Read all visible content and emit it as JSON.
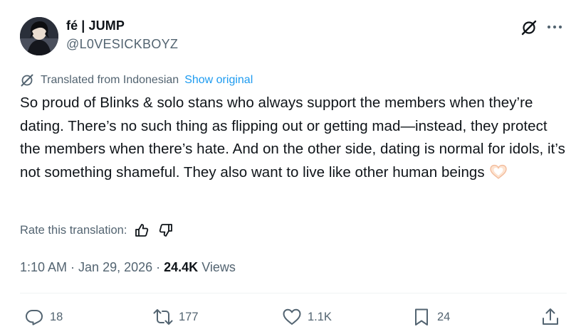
{
  "author": {
    "display_name": "fé | JUMP",
    "handle": "@L0VESICKBOYZ"
  },
  "icons": {
    "grok": "grok-slash-icon",
    "more": "more-dots-icon",
    "translate": "translate-icon",
    "thumbs_up": "thumbs-up-icon",
    "thumbs_down": "thumbs-down-icon",
    "reply": "reply-icon",
    "retweet": "retweet-icon",
    "like": "heart-icon",
    "bookmark": "bookmark-icon",
    "share": "share-icon",
    "emoji": "heart-hands-emoji"
  },
  "translation": {
    "notice": "Translated from Indonesian",
    "show_original": "Show original"
  },
  "tweet": {
    "text": "So proud of Blinks & solo stans who always support the members when they’re dating. There’s no such thing as flipping out or getting mad—instead, they protect the members when there’s hate. And on the other side, dating is normal for idols, it’s not something shameful. They also want to live like other human beings"
  },
  "rate": {
    "label": "Rate this translation:"
  },
  "meta": {
    "time": "1:10 AM",
    "sep1": " · ",
    "date": "Jan 29, 2026",
    "sep2": " · ",
    "views_count": "24.4K",
    "views_label": "Views"
  },
  "actions": {
    "replies": "18",
    "retweets": "177",
    "likes": "1.1K",
    "bookmarks": "24"
  },
  "colors": {
    "text": "#0f1419",
    "secondary": "#536471",
    "link": "#1d9bf0",
    "divider": "#eff3f4"
  }
}
